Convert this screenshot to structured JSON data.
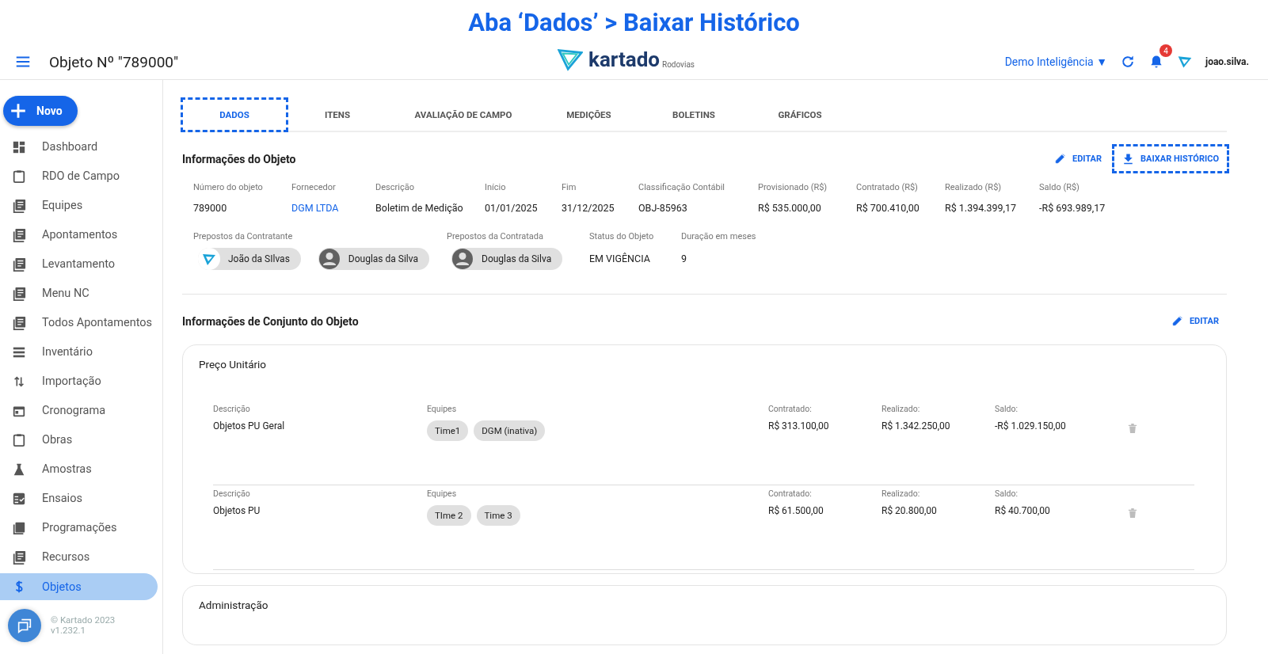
{
  "banner": {
    "title": "Aba ‘Dados’ > Baixar Histórico"
  },
  "header": {
    "title": "Objeto Nº \"789000\"",
    "logo_text": "kartado",
    "logo_sub": "Rodovias",
    "company": "Demo Inteligência ▼",
    "notifications": "4",
    "user": "joao.silva."
  },
  "sidebar": {
    "new_button": "Novo",
    "items": [
      {
        "label": "Dashboard",
        "selected": false
      },
      {
        "label": "RDO de Campo",
        "selected": false
      },
      {
        "label": "Equipes",
        "selected": false
      },
      {
        "label": "Apontamentos",
        "selected": false
      },
      {
        "label": "Levantamento",
        "selected": false
      },
      {
        "label": "Menu NC",
        "selected": false
      },
      {
        "label": "Todos Apontamentos",
        "selected": false
      },
      {
        "label": "Inventário",
        "selected": false
      },
      {
        "label": "Importação",
        "selected": false
      },
      {
        "label": "Cronograma",
        "selected": false
      },
      {
        "label": "Obras",
        "selected": false
      },
      {
        "label": "Amostras",
        "selected": false
      },
      {
        "label": "Ensaios",
        "selected": false
      },
      {
        "label": "Programações",
        "selected": false
      },
      {
        "label": "Recursos",
        "selected": false
      },
      {
        "label": "Objetos",
        "selected": true
      }
    ],
    "footer": [
      "© Kartado 2023",
      "v1.232.1"
    ]
  },
  "tabs": [
    {
      "label": "DADOS",
      "selected": true,
      "highlighted": true
    },
    {
      "label": "ITENS",
      "selected": false,
      "highlighted": false
    },
    {
      "label": "AVALIAÇÃO DE CAMPO",
      "selected": false,
      "highlighted": false
    },
    {
      "label": "MEDIÇÕES",
      "selected": false,
      "highlighted": false
    },
    {
      "label": "BOLETINS",
      "selected": false,
      "highlighted": false
    },
    {
      "label": "GRÁFICOS",
      "selected": false,
      "highlighted": false
    }
  ],
  "object_info": {
    "title": "Informações do Objeto",
    "edit": "EDITAR",
    "download": {
      "label": "BAIXAR HISTÓRICO",
      "highlighted": true
    },
    "fields": [
      {
        "label": "Número do objeto",
        "value": "789000",
        "kind": "text"
      },
      {
        "label": "Fornecedor",
        "value": "DGM LTDA",
        "kind": "link"
      },
      {
        "label": "Descrição",
        "value": "Boletim de Medição",
        "kind": "text"
      },
      {
        "label": "Início",
        "value": "01/01/2025",
        "kind": "text"
      },
      {
        "label": "Fim",
        "value": "31/12/2025",
        "kind": "text"
      },
      {
        "label": "Classificação Contábil",
        "value": "OBJ-85963",
        "kind": "text"
      },
      {
        "label": "Provisionado (R$)",
        "value": "R$ 535.000,00",
        "kind": "text"
      },
      {
        "label": "Contratado (R$)",
        "value": "R$ 700.410,00",
        "kind": "text"
      },
      {
        "label": "Realizado (R$)",
        "value": "R$ 1.394.399,17",
        "kind": "text"
      },
      {
        "label": "Saldo (R$)",
        "value": "-R$ 693.989,17",
        "kind": "text"
      }
    ],
    "people": [
      {
        "label": "Prepostos da Contratante",
        "chips": [
          {
            "name": "João da SIlvas",
            "kind": "logo"
          },
          {
            "name": "Douglas da Silva",
            "kind": "person"
          }
        ]
      },
      {
        "label": "Prepostos da Contratada",
        "chips": [
          {
            "name": "Douglas da Silva",
            "kind": "person"
          }
        ]
      }
    ],
    "status": [
      {
        "label": "Status do Objeto",
        "value": "EM VIGÊNCIA"
      },
      {
        "label": "Duração em meses",
        "value": "9"
      }
    ]
  },
  "set_info": {
    "title": "Informações de Conjunto do Objeto",
    "edit": "EDITAR",
    "cards": [
      {
        "title": "Preço Unitário",
        "rows": [
          {
            "description_label": "Descrição",
            "description": "Objetos PU Geral",
            "teams_label": "Equipes",
            "teams": [
              "Time1",
              "DGM (inativa)"
            ],
            "contracted_label": "Contratado:",
            "contracted": "R$ 313.100,00",
            "realized_label": "Realizado:",
            "realized": "R$ 1.342.250,00",
            "balance_label": "Saldo:",
            "balance": "-R$ 1.029.150,00"
          },
          {
            "description_label": "Descrição",
            "description": "Objetos PU",
            "teams_label": "Equipes",
            "teams": [
              "TIme 2",
              "Time 3"
            ],
            "contracted_label": "Contratado:",
            "contracted": "R$ 61.500,00",
            "realized_label": "Realizado:",
            "realized": "R$ 20.800,00",
            "balance_label": "Saldo:",
            "balance": "R$ 40.700,00"
          }
        ]
      },
      {
        "title": "Administração"
      }
    ]
  }
}
